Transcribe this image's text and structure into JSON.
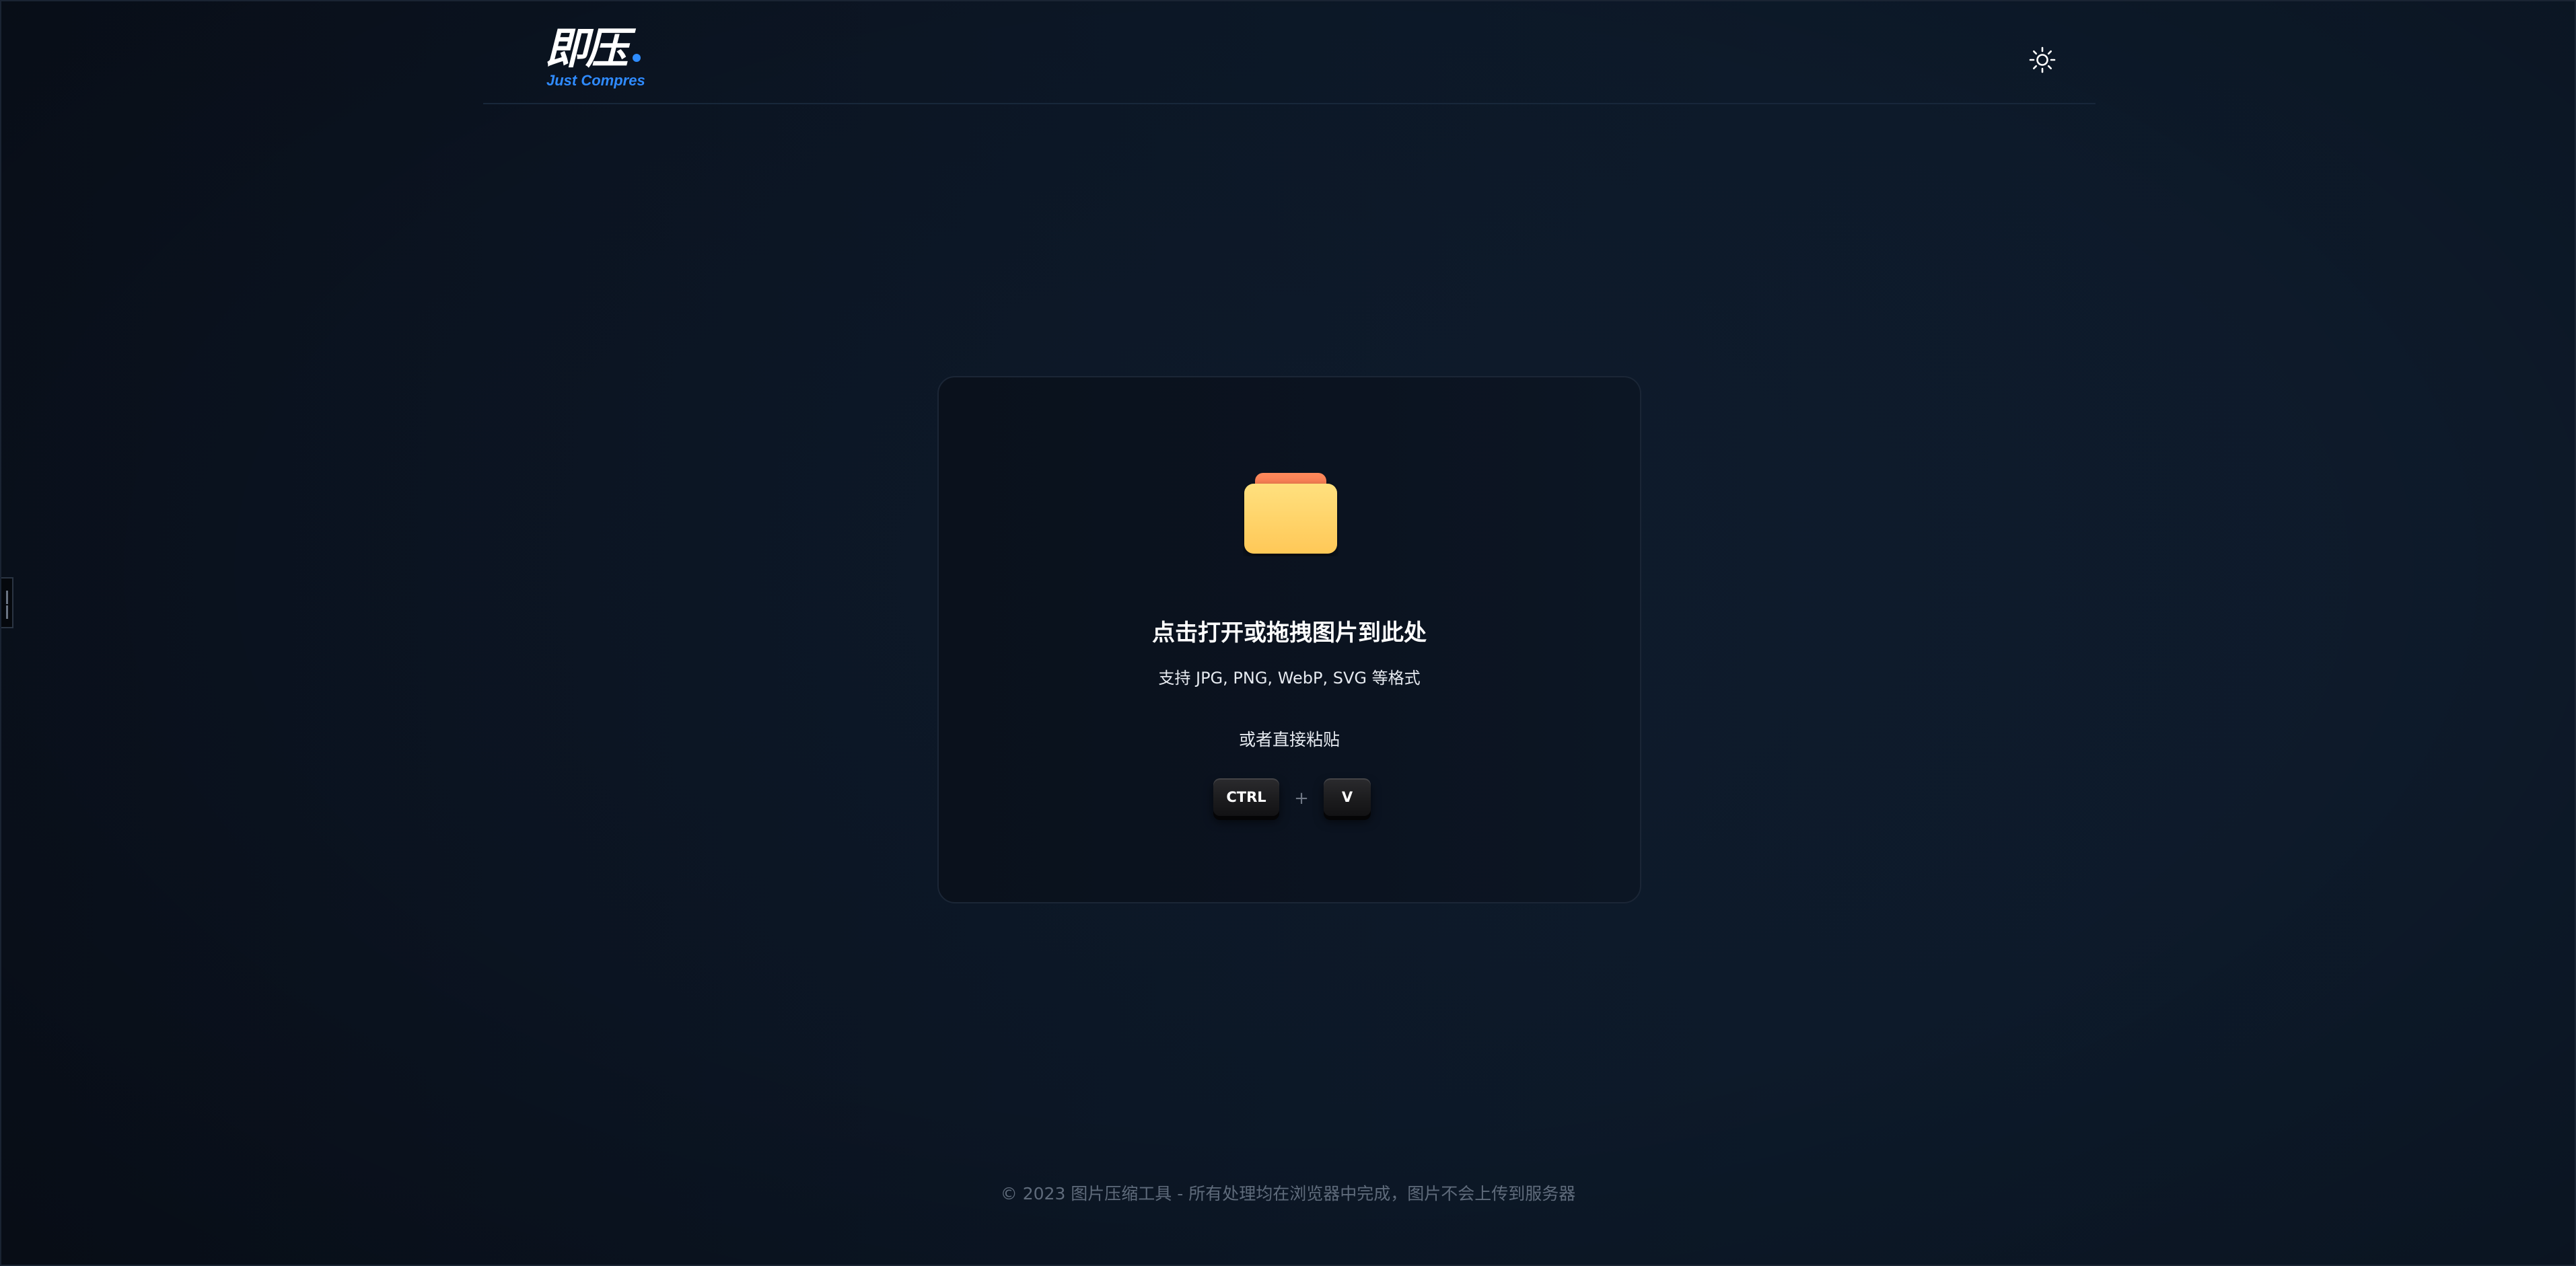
{
  "header": {
    "logo_text": "即压",
    "logo_subtitle": "Just Compres",
    "theme_toggle_icon": "sun-icon"
  },
  "dropzone": {
    "icon": "folder-icon",
    "title": "点击打开或拖拽图片到此处",
    "formats": "支持 JPG, PNG, WebP, SVG 等格式",
    "paste_label": "或者直接粘贴",
    "key_ctrl": "CTRL",
    "key_plus": "+",
    "key_v": "V"
  },
  "footer": {
    "text": "© 2023 图片压缩工具 - 所有处理均在浏览器中完成，图片不会上传到服务器"
  },
  "colors": {
    "background": "#0c1422",
    "card": "#0b1320",
    "accent_blue": "#2f8bff",
    "folder_body": "#ffd36a",
    "folder_tab": "#f47c55"
  }
}
